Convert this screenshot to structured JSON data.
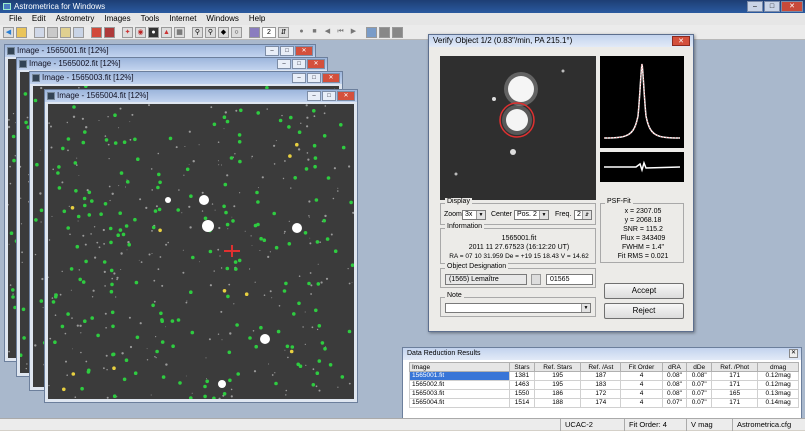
{
  "app": {
    "title": "Astrometrica for Windows"
  },
  "menu": [
    "File",
    "Edit",
    "Astrometry",
    "Images",
    "Tools",
    "Internet",
    "Windows",
    "Help"
  ],
  "toolbar": {
    "counter_value": "2"
  },
  "image_windows": [
    {
      "title": "Image - 1565001.fit [12%]"
    },
    {
      "title": "Image - 1565002.fit [12%]"
    },
    {
      "title": "Image - 1565003.fit [12%]"
    },
    {
      "title": "Image - 1565004.fit [12%]"
    }
  ],
  "verify": {
    "title": "Verify Object 1/2 (0.83\"/min, PA 215.1°)",
    "display": {
      "label": "Display",
      "zoom_label": "Zoom",
      "zoom_value": "3x",
      "center_label": "Center",
      "center_value": "Pos. 2",
      "freq_label": "Freq.",
      "freq_value": "2"
    },
    "psf": {
      "label": "PSF-Fit",
      "x": "x = 2307.05",
      "y": "y = 2068.18",
      "snr": "SNR = 115.2",
      "flux": "Flux = 343409",
      "fwhm": "FWHM = 1.4\"",
      "fitrms": "Fit RMS = 0.021"
    },
    "info": {
      "label": "Information",
      "file": "1565001.fit",
      "date": "2011 11 27.67523 (16:12:20 UT)",
      "coords": "RA = 07 10 31.959  De = +19 15 18.43  V = 14.62"
    },
    "designation": {
      "label": "Object Designation",
      "name": "(1565) Lemaître",
      "number": "01565"
    },
    "note": {
      "label": "Note",
      "value": ""
    },
    "accept_label": "Accept",
    "reject_label": "Reject"
  },
  "results": {
    "title": "Data Reduction Results",
    "columns": [
      "Image",
      "Stars",
      "Ref. Stars",
      "Ref. /Ast",
      "Fit Order",
      "dRA",
      "dDe",
      "Ref. /Phot",
      "dmag"
    ],
    "rows": [
      [
        "1565001.fit",
        "1381",
        "195",
        "187",
        "4",
        "0.08\"",
        "0.08\"",
        "171",
        "0.12mag"
      ],
      [
        "1565002.fit",
        "1463",
        "195",
        "183",
        "4",
        "0.08\"",
        "0.07\"",
        "171",
        "0.12mag"
      ],
      [
        "1565003.fit",
        "1550",
        "186",
        "172",
        "4",
        "0.08\"",
        "0.07\"",
        "165",
        "0.13mag"
      ],
      [
        "1565004.fit",
        "1514",
        "188",
        "174",
        "4",
        "0.07\"",
        "0.07\"",
        "171",
        "0.14mag"
      ]
    ]
  },
  "status": {
    "catalog": "UCAC-2",
    "fit_order": "Fit Order: 4",
    "mag": "V mag",
    "config": "Astrometrica.cfg"
  },
  "colors": {
    "title_bar": "#1d3e74",
    "mdi_background": "#a9b8cc",
    "star_marker": "#2ecc40",
    "target_circle": "#e03030",
    "selection": "#3875d7"
  }
}
